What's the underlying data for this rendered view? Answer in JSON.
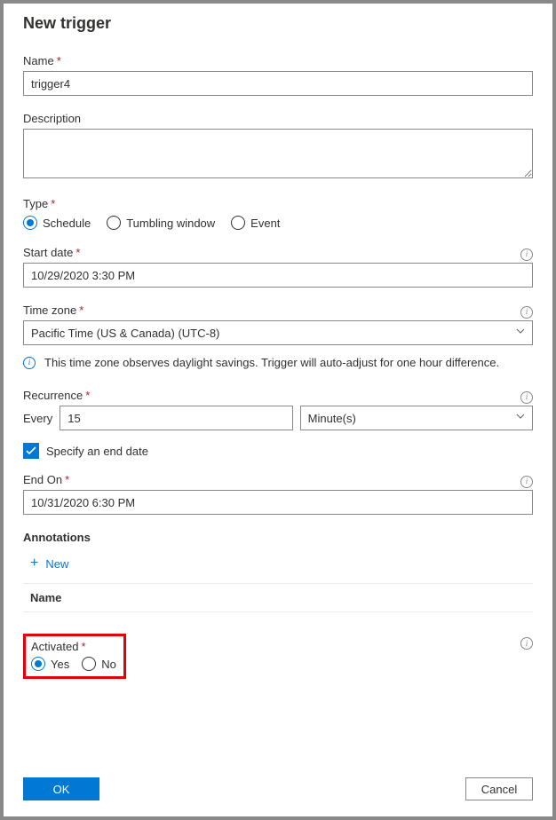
{
  "title": "New trigger",
  "name": {
    "label": "Name",
    "value": "trigger4"
  },
  "description": {
    "label": "Description",
    "value": ""
  },
  "type": {
    "label": "Type",
    "options": {
      "schedule": "Schedule",
      "tumbling": "Tumbling window",
      "event": "Event"
    },
    "selected": "schedule"
  },
  "startDate": {
    "label": "Start date",
    "value": "10/29/2020 3:30 PM"
  },
  "timeZone": {
    "label": "Time zone",
    "value": "Pacific Time (US & Canada) (UTC-8)"
  },
  "timeZoneNote": "This time zone observes daylight savings. Trigger will auto-adjust for one hour difference.",
  "recurrence": {
    "label": "Recurrence",
    "everyLabel": "Every",
    "everyValue": "15",
    "unitValue": "Minute(s)"
  },
  "specifyEndDate": {
    "label": "Specify an end date",
    "checked": true
  },
  "endOn": {
    "label": "End On",
    "value": "10/31/2020 6:30 PM"
  },
  "annotations": {
    "label": "Annotations",
    "newLabel": "New",
    "columnName": "Name"
  },
  "activated": {
    "label": "Activated",
    "yes": "Yes",
    "no": "No",
    "selected": "yes"
  },
  "footer": {
    "ok": "OK",
    "cancel": "Cancel"
  }
}
